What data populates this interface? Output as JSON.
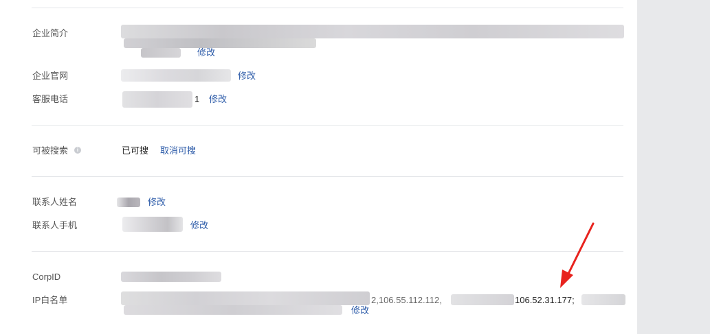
{
  "fields": {
    "company_intro_label": "企业简介",
    "website_label": "企业官网",
    "service_phone_label": "客服电话",
    "searchable_label": "可被搜索",
    "contact_name_label": "联系人姓名",
    "contact_phone_label": "联系人手机",
    "corpid_label": "CorpID",
    "ip_whitelist_label": "IP白名单"
  },
  "values": {
    "service_phone_tail": "1",
    "searchable_status": "已可搜",
    "ip_partial_1": "2,106.55.112.112,",
    "ip_visible": "106.52.31.177;"
  },
  "actions": {
    "edit": "修改",
    "cancel_searchable": "取消可搜"
  },
  "colors": {
    "link": "#2b5aa8",
    "arrow": "#e8231e"
  },
  "icons": {
    "searchable_info": "info-icon"
  }
}
